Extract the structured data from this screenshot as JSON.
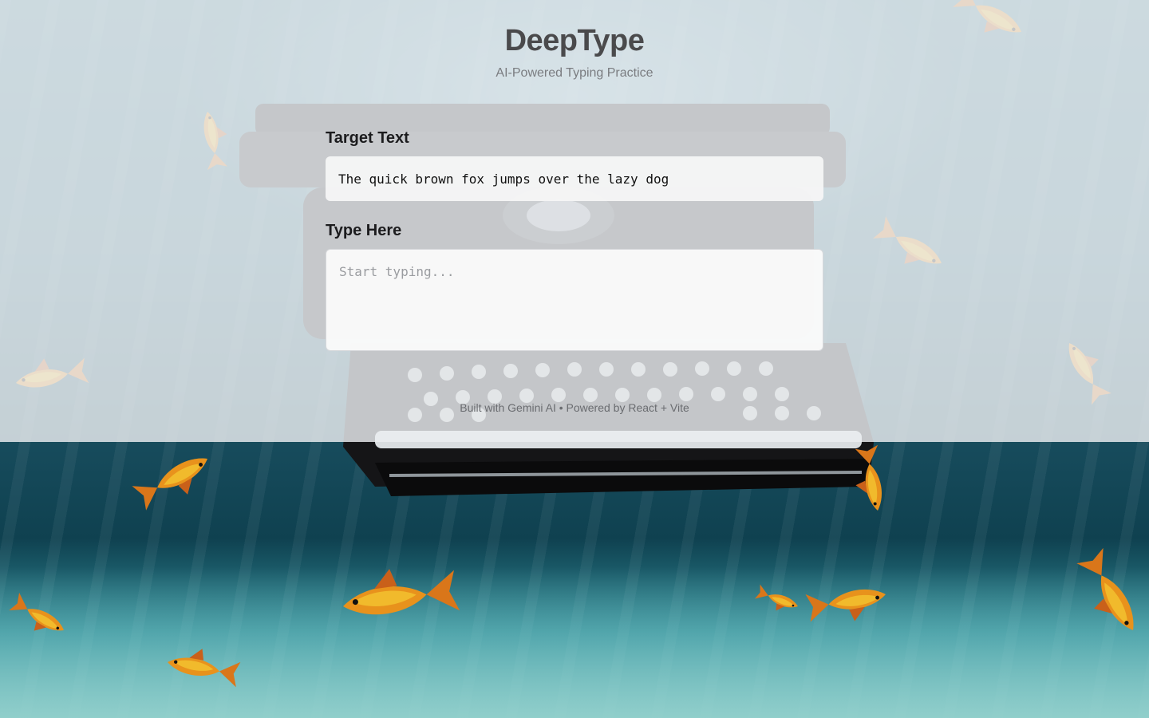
{
  "header": {
    "title": "DeepType",
    "subtitle": "AI-Powered Typing Practice"
  },
  "target": {
    "label": "Target Text",
    "text": "The quick brown fox jumps over the lazy dog"
  },
  "input": {
    "label": "Type Here",
    "value": "",
    "placeholder": "Start typing..."
  },
  "footer": {
    "text": "Built with Gemini AI • Powered by React + Vite"
  },
  "background": {
    "scene": "underwater-typewriter-with-goldfish",
    "icons": [
      "typewriter-illustration",
      "goldfish-illustration"
    ]
  }
}
